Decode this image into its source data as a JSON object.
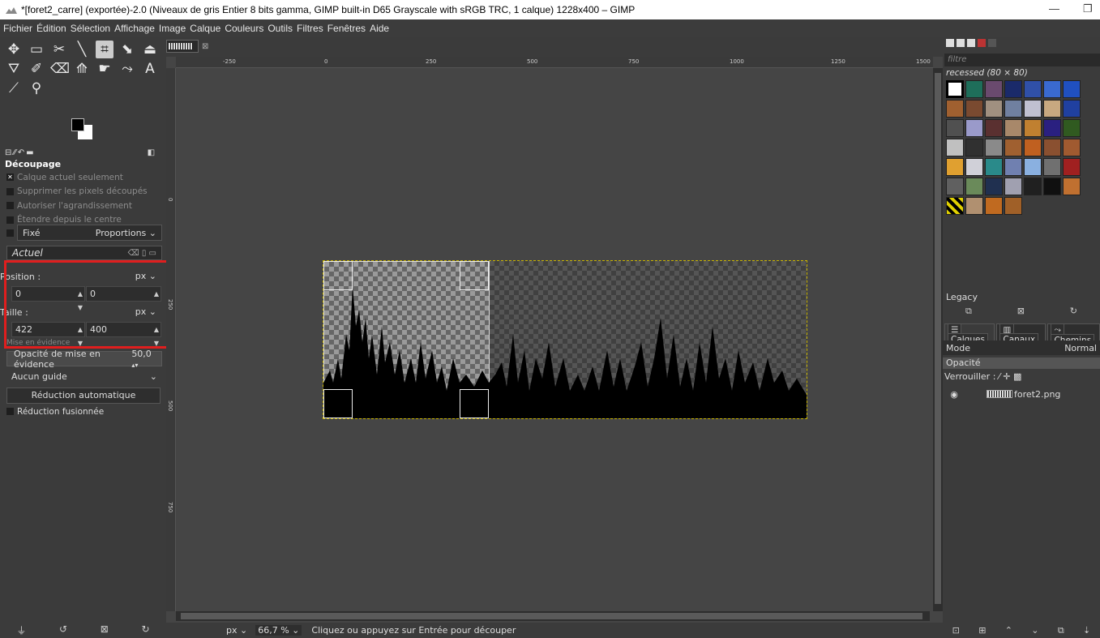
{
  "window": {
    "title": "*[foret2_carre] (exportée)-2.0 (Niveaux de gris Entier 8 bits gamma, GIMP built-in D65 Grayscale with sRGB TRC, 1 calque) 1228x400 – GIMP",
    "minimize_icon": "minimize-icon",
    "restore_icon": "restore-icon"
  },
  "menu": [
    "Fichier",
    "Édition",
    "Sélection",
    "Affichage",
    "Image",
    "Calque",
    "Couleurs",
    "Outils",
    "Filtres",
    "Fenêtres",
    "Aide"
  ],
  "tools": [
    {
      "name": "move-tool-icon",
      "glyph": "✥"
    },
    {
      "name": "rect-select-tool-icon",
      "glyph": "▭"
    },
    {
      "name": "scissors-tool-icon",
      "glyph": "✂"
    },
    {
      "name": "fuzzy-select-tool-icon",
      "glyph": "⟋"
    },
    {
      "name": "crop-tool-icon",
      "glyph": "⌗"
    },
    {
      "name": "unified-transform-tool-icon",
      "glyph": "⬊"
    },
    {
      "name": "warp-tool-icon",
      "glyph": "⏏"
    },
    {
      "name": "bucket-fill-tool-icon",
      "glyph": "⛛"
    },
    {
      "name": "paintbrush-tool-icon",
      "glyph": "✐"
    },
    {
      "name": "eraser-tool-icon",
      "glyph": "⌫"
    },
    {
      "name": "clone-tool-icon",
      "glyph": "⟰"
    },
    {
      "name": "smudge-tool-icon",
      "glyph": "☛"
    },
    {
      "name": "paths-tool-icon",
      "glyph": "⤳"
    },
    {
      "name": "text-tool-icon",
      "glyph": "A"
    },
    {
      "name": "color-picker-tool-icon",
      "glyph": "⟋"
    },
    {
      "name": "zoom-tool-icon",
      "glyph": "⚲"
    }
  ],
  "tool_options": {
    "title": "Découpage",
    "checks": [
      {
        "label": "Calque actuel seulement",
        "checked": true
      },
      {
        "label": "Supprimer les pixels découpés",
        "checked": false
      },
      {
        "label": "Autoriser l'agrandissement",
        "checked": false
      },
      {
        "label": "Étendre depuis le centre",
        "checked": false
      }
    ],
    "fixe_label": "Fixé",
    "proportions_value": "Proportions",
    "actuel_label": "Actuel",
    "position_label": "Position :",
    "position_unit": "px",
    "position_x": "0",
    "position_y": "0",
    "taille_label": "Taille :",
    "taille_unit": "px",
    "taille_w": "422",
    "taille_h": "400",
    "mise_en_evidence_label": "Mise en évidence",
    "opacite_label": "Opacité de mise en évidence",
    "opacite_value": "50,0",
    "guide_value": "Aucun guide",
    "reduction_auto_label": "Réduction automatique",
    "reduction_fusionnee_label": "Réduction fusionnée"
  },
  "ruler_h_ticks": [
    "-250",
    "0",
    "250",
    "500",
    "750",
    "1000",
    "1250",
    "1500"
  ],
  "ruler_v_ticks": [
    "0",
    "250",
    "500",
    "750"
  ],
  "status": {
    "unit": "px",
    "zoom": "66,7 %",
    "message": "Cliquez ou appuyez sur Entrée pour découper"
  },
  "patterns": {
    "filter_placeholder": "filtre",
    "selected_name": "recessed (80 × 80)"
  },
  "layers_panel": {
    "legacy_label": "Legacy",
    "tabs": [
      "Calques",
      "Canaux",
      "Chemins"
    ],
    "mode_label": "Mode",
    "mode_value": "Normal",
    "opacite_label": "Opacité",
    "verrou_label": "Verrouiller :",
    "layer_name": "foret2.png"
  },
  "colors": {
    "highlight_red": "#e01e1e",
    "selection_yellow": "#c8b400"
  }
}
